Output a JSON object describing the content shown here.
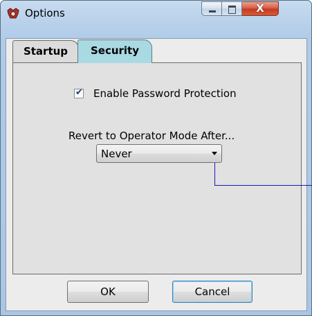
{
  "window": {
    "title": "Options",
    "app_icon": "settings-gear-icon",
    "caption_buttons": {
      "minimize": "minimize-icon",
      "maximize": "maximize-icon",
      "close_glyph": "X"
    }
  },
  "tabs": [
    {
      "label": "Startup",
      "selected": false
    },
    {
      "label": "Security",
      "selected": true
    }
  ],
  "security": {
    "enable_password": {
      "label": "Enable Password Protection",
      "checked": true
    },
    "revert_label": "Revert to Operator Mode After...",
    "revert_select": {
      "value": "Never"
    }
  },
  "footer": {
    "ok_label": "OK",
    "cancel_label": "Cancel"
  },
  "colors": {
    "selected_tab": "#a9d9e3",
    "callout_line": "#1b1bb0",
    "close_button": "#c7381f"
  }
}
